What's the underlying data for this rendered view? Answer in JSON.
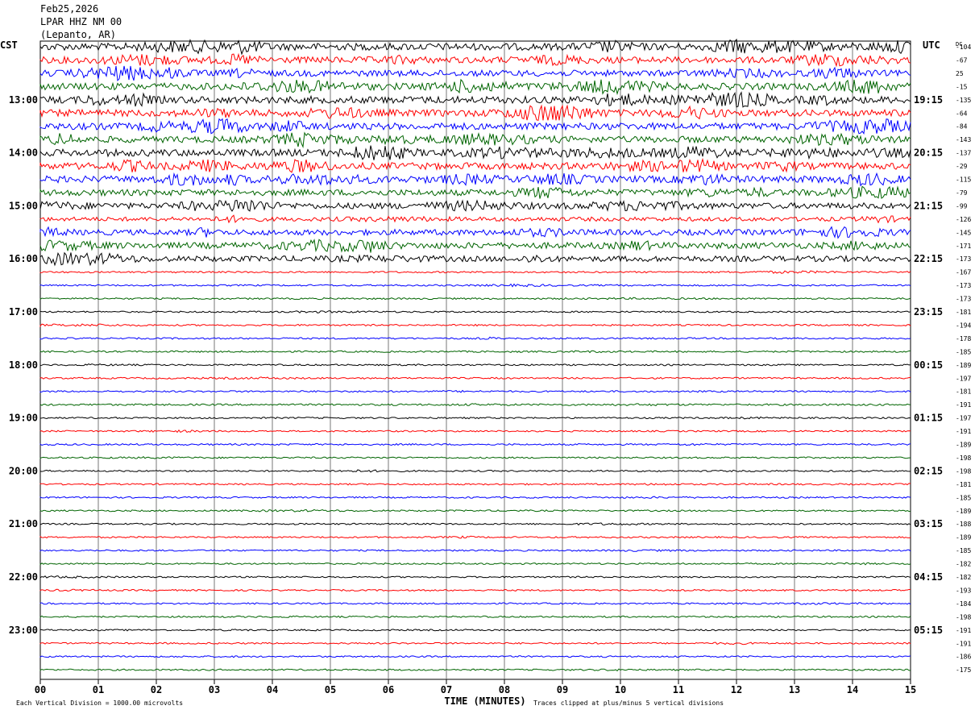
{
  "header": {
    "date": "Feb25,2026",
    "station": "LPAR HHZ NM 00",
    "location": "(Lepanto, AR)"
  },
  "chart_data": {
    "type": "line",
    "title": "Feb25,2026",
    "left_tz_label": "CST",
    "right_tz_label": "UTC",
    "dc_label": "DC",
    "xlabel": "TIME (MINUTES)",
    "x_ticks": [
      "00",
      "01",
      "02",
      "03",
      "04",
      "05",
      "06",
      "07",
      "08",
      "09",
      "10",
      "11",
      "12",
      "13",
      "14",
      "15"
    ],
    "xlim": [
      0,
      15
    ],
    "left_hour_labels": [
      "13:00",
      "14:00",
      "15:00",
      "16:00",
      "17:00",
      "18:00",
      "19:00",
      "20:00",
      "21:00",
      "22:00",
      "23:00"
    ],
    "right_hour_labels": [
      "19:15",
      "20:15",
      "21:15",
      "22:15",
      "23:15",
      "00:15",
      "01:15",
      "02:15",
      "03:15",
      "04:15",
      "05:15"
    ],
    "trace_colors": [
      "#000000",
      "#ff0000",
      "#0000ff",
      "#006400"
    ],
    "dc_offsets": [
      -104,
      -67,
      25,
      -15,
      -135,
      -64,
      -84,
      -143,
      -137,
      -29,
      -115,
      -79,
      -99,
      -126,
      -145,
      -171,
      -173,
      -167,
      -173,
      -173,
      -181,
      -194,
      -178,
      -185,
      -189,
      -197,
      -181,
      -191,
      -197,
      -191,
      -189,
      -198,
      -198,
      -181,
      -185,
      -189,
      -188,
      -189,
      -185,
      -182,
      -182,
      -193,
      -184,
      -198,
      -191,
      -191,
      -186,
      -175
    ],
    "trace_activity": [
      0.95,
      0.85,
      0.8,
      0.9,
      0.95,
      0.9,
      0.9,
      0.85,
      0.95,
      0.9,
      0.9,
      0.8,
      0.75,
      0.45,
      0.7,
      0.8,
      0.7,
      0.2,
      0.2,
      0.2,
      0.18,
      0.2,
      0.2,
      0.2,
      0.18,
      0.2,
      0.2,
      0.25,
      0.18,
      0.18,
      0.2,
      0.18,
      0.18,
      0.18,
      0.18,
      0.18,
      0.18,
      0.18,
      0.18,
      0.18,
      0.18,
      0.18,
      0.18,
      0.18,
      0.18,
      0.18,
      0.18,
      0.18
    ],
    "footer_left": "Each Vertical Division = 1000.00 microvolts",
    "footer_right": "Traces clipped at plus/minus 5 vertical divisions"
  }
}
